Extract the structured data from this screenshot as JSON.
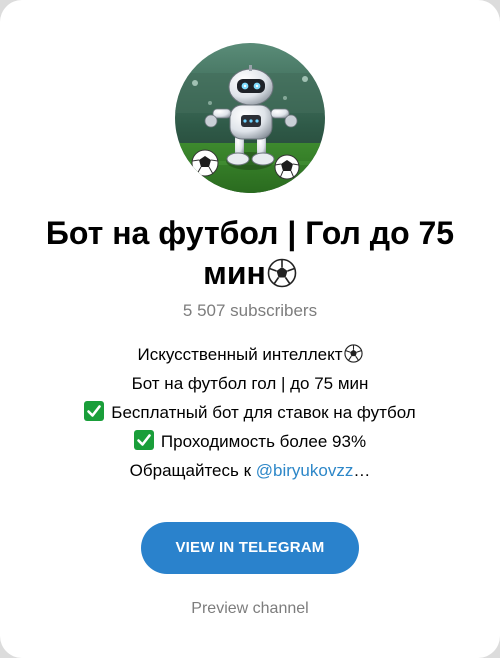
{
  "channel": {
    "avatar_description_icon": "robot-footballer-icon",
    "title": "Бот на футбол | Гол до 75 мин",
    "title_emoji_icon": "soccer-ball-icon",
    "subscribers": "5 507 subscribers"
  },
  "description": {
    "line1": "Искусственный интеллект",
    "line1_emoji_icon": "soccer-ball-icon",
    "line2": "Бот на футбол гол | до 75 мин",
    "line3": "Бесплатный бот для ставок на футбол",
    "line3_emoji_icon": "check-mark-button-icon",
    "line4": "Проходимость более 93%",
    "line4_emoji_icon": "check-mark-button-icon",
    "line5_prefix": "Обращайтесь к ",
    "line5_mention": "@biryukovzz",
    "line5_suffix": "…"
  },
  "actions": {
    "view_button_label": "VIEW IN TELEGRAM",
    "preview_link_label": "Preview channel"
  },
  "colors": {
    "accent": "#2a82cc",
    "mention": "#2d87c8",
    "muted_text": "#7d7d7d",
    "check_green": "#1a9e3a"
  }
}
